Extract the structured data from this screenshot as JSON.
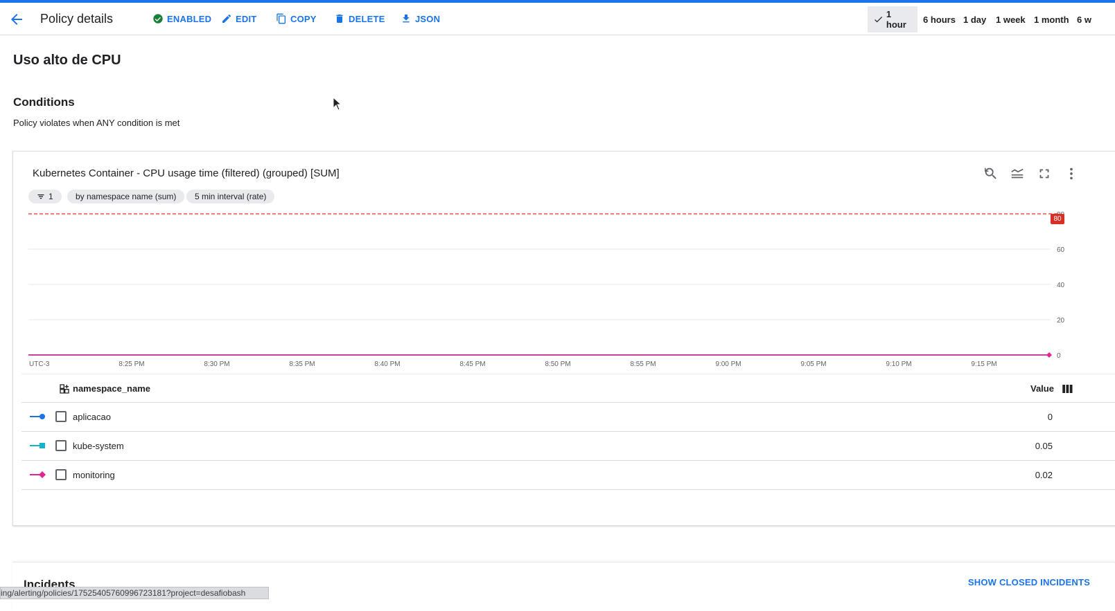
{
  "header": {
    "title": "Policy details",
    "actions": {
      "enabled": "ENABLED",
      "edit": "EDIT",
      "copy": "COPY",
      "delete": "DELETE",
      "json": "JSON"
    },
    "time_ranges": [
      "1 hour",
      "6 hours",
      "1 day",
      "1 week",
      "1 month",
      "6 w"
    ],
    "selected_range": "1 hour"
  },
  "policy_name": "Uso alto de CPU",
  "conditions": {
    "heading": "Conditions",
    "description": "Policy violates when ANY condition is met"
  },
  "chart_card": {
    "title": "Kubernetes Container - CPU usage time (filtered) (grouped) [SUM]",
    "chips": [
      "1",
      "by namespace name (sum)",
      "5 min interval (rate)"
    ],
    "threshold_label": "80",
    "chart_data": {
      "type": "line",
      "timezone_label": "UTC-3",
      "x": [
        "8:25 PM",
        "8:30 PM",
        "8:35 PM",
        "8:40 PM",
        "8:45 PM",
        "8:50 PM",
        "8:55 PM",
        "9:00 PM",
        "9:05 PM",
        "9:10 PM",
        "9:15 PM"
      ],
      "y_ticks": [
        0,
        20,
        40,
        60,
        80
      ],
      "ylim": [
        0,
        80
      ],
      "threshold": 80,
      "series": [
        {
          "name": "aplicacao",
          "values": [
            0,
            0,
            0,
            0,
            0,
            0,
            0,
            0,
            0,
            0,
            0
          ],
          "color": "#1a73e8"
        },
        {
          "name": "kube-system",
          "values": [
            0.05,
            0.05,
            0.05,
            0.05,
            0.05,
            0.05,
            0.05,
            0.05,
            0.05,
            0.05,
            0.05
          ],
          "color": "#12b5cb"
        },
        {
          "name": "monitoring",
          "values": [
            0.02,
            0.02,
            0.02,
            0.02,
            0.02,
            0.02,
            0.02,
            0.02,
            0.02,
            0.02,
            0.02
          ],
          "color": "#e52592"
        }
      ],
      "grid": true
    },
    "table": {
      "column_name": "namespace_name",
      "value_header": "Value",
      "rows": [
        {
          "name": "aplicacao",
          "value": "0"
        },
        {
          "name": "kube-system",
          "value": "0.05"
        },
        {
          "name": "monitoring",
          "value": "0.02"
        }
      ]
    }
  },
  "incidents": {
    "title": "Incidents",
    "show_closed": "SHOW CLOSED INCIDENTS"
  },
  "status_bar": "ing/alerting/policies/17525405760996723181?project=desafiobash"
}
